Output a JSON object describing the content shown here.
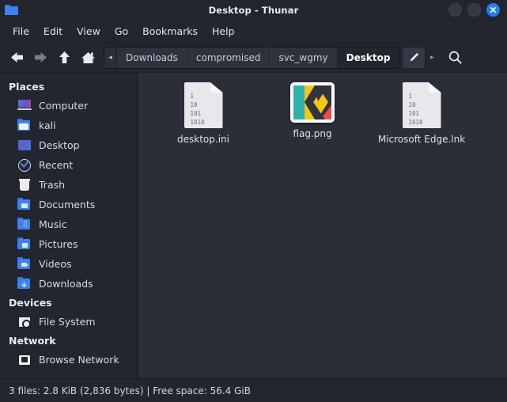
{
  "window": {
    "title": "Desktop - Thunar",
    "icon": "folder-icon",
    "buttons": [
      {
        "name": "minimize",
        "label": ""
      },
      {
        "name": "maximize",
        "label": ""
      },
      {
        "name": "close",
        "label": "×"
      }
    ]
  },
  "menubar": {
    "items": [
      {
        "label": "File"
      },
      {
        "label": "Edit"
      },
      {
        "label": "View"
      },
      {
        "label": "Go"
      },
      {
        "label": "Bookmarks"
      },
      {
        "label": "Help"
      }
    ]
  },
  "toolbar": {
    "nav": [
      {
        "name": "back-icon",
        "enabled": true
      },
      {
        "name": "forward-icon",
        "enabled": false
      },
      {
        "name": "up-icon",
        "enabled": true
      },
      {
        "name": "home-icon",
        "enabled": true
      }
    ],
    "pathbar": {
      "scroll_left": "◂",
      "scroll_right": "▸",
      "crumbs": [
        {
          "label": "Downloads",
          "active": false
        },
        {
          "label": "compromised",
          "active": false
        },
        {
          "label": "svc_wgmy",
          "active": false
        },
        {
          "label": "Desktop",
          "active": true
        }
      ],
      "edit_icon": "pencil-icon"
    },
    "search_icon": "search-icon"
  },
  "sidebar": {
    "groups": [
      {
        "heading": "Places",
        "items": [
          {
            "label": "Computer",
            "icon": "computer-icon"
          },
          {
            "label": "kali",
            "icon": "home-folder-icon"
          },
          {
            "label": "Desktop",
            "icon": "desktop-icon"
          },
          {
            "label": "Recent",
            "icon": "recent-clock-icon"
          },
          {
            "label": "Trash",
            "icon": "trash-icon"
          },
          {
            "label": "Documents",
            "icon": "documents-folder-icon"
          },
          {
            "label": "Music",
            "icon": "music-folder-icon"
          },
          {
            "label": "Pictures",
            "icon": "pictures-folder-icon"
          },
          {
            "label": "Videos",
            "icon": "videos-folder-icon"
          },
          {
            "label": "Downloads",
            "icon": "downloads-folder-icon"
          }
        ]
      },
      {
        "heading": "Devices",
        "items": [
          {
            "label": "File System",
            "icon": "harddisk-icon"
          }
        ]
      },
      {
        "heading": "Network",
        "items": [
          {
            "label": "Browse Network",
            "icon": "network-icon"
          }
        ]
      }
    ]
  },
  "files": [
    {
      "name": "desktop.ini",
      "type": "document",
      "bits": [
        "1",
        "10",
        "101",
        "1010"
      ]
    },
    {
      "name": "flag.png",
      "type": "image-thumbnail",
      "bits": []
    },
    {
      "name": "Microsoft Edge.lnk",
      "type": "document",
      "bits": [
        "1",
        "10",
        "101",
        "1010"
      ]
    }
  ],
  "statusbar": {
    "text": "3 files: 2.8 KiB (2,836 bytes)  |  Free space: 56.4 GiB"
  },
  "colors": {
    "window_bg": "#2b2e38",
    "chrome_bg": "#23262e",
    "titlebar_bg": "#22252d",
    "accent_blue": "#2680eb",
    "folder_blue": "#3b82f6",
    "text": "#dde0e8"
  }
}
